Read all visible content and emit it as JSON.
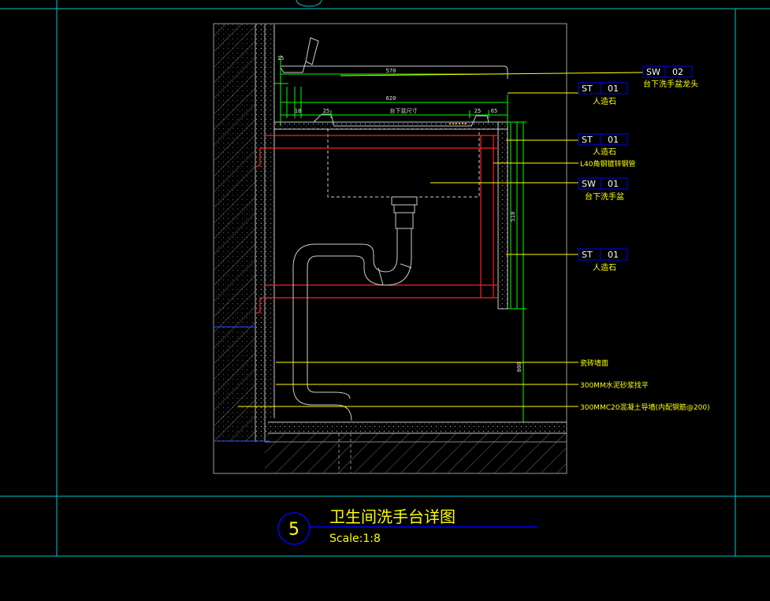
{
  "title_block": {
    "number": "5",
    "title": "卫生间洗手台详图",
    "scale": "Scale:1:8"
  },
  "tags": [
    {
      "code": "SW",
      "num": "02",
      "desc": "台下洗手盆龙头"
    },
    {
      "code": "ST",
      "num": "01",
      "desc": "人造石"
    },
    {
      "code": "ST",
      "num": "01",
      "desc": "人造石"
    },
    {
      "code": "SW",
      "num": "01",
      "desc": "台下洗手盆"
    },
    {
      "code": "ST",
      "num": "01",
      "desc": "人造石"
    }
  ],
  "notes": {
    "steel": "L40角钢镀锌钢管",
    "wall_tile": "瓷砖墙面",
    "mortar": "300MM水泥砂浆找平",
    "concrete": "300MMC20混凝土导墙(内配钢筋@200)"
  },
  "dims": {
    "d570": "570",
    "d620": "620",
    "d25a": "25",
    "d25b": "25",
    "d65": "65",
    "d15": "15",
    "d18": "18",
    "basin_label": "台下盆尺寸",
    "right_height": "510",
    "total_height": "800"
  },
  "colors": {
    "frame": "#00c8c8",
    "leader": "#ffff00",
    "tag_box": "#0000ff",
    "accent_red": "#ff2020",
    "green": "#00ff00"
  }
}
